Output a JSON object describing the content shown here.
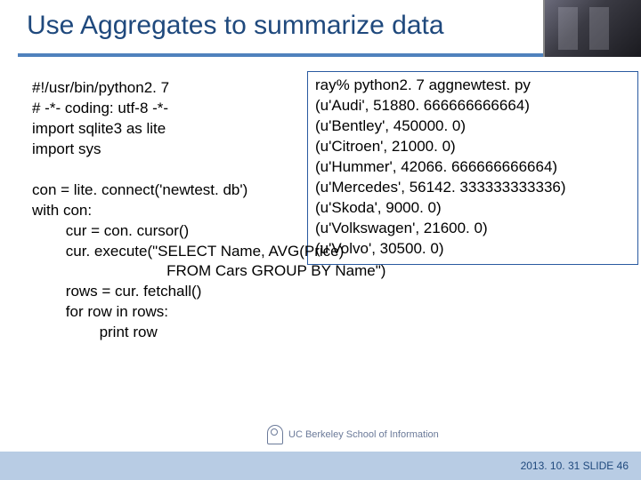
{
  "title": "Use Aggregates to summarize data",
  "code": "#!/usr/bin/python2. 7\n# -*- coding: utf-8 -*-\nimport sqlite3 as lite\nimport sys\n\ncon = lite. connect('newtest. db')\nwith con:\n        cur = con. cursor()\n        cur. execute(\"SELECT Name, AVG(Price)\n                                FROM Cars GROUP BY Name\")\n        rows = cur. fetchall()\n        for row in rows:\n                print row",
  "output": "ray% python2. 7 aggnewtest. py\n(u'Audi', 51880. 666666666664)\n(u'Bentley', 450000. 0)\n(u'Citroen', 21000. 0)\n(u'Hummer', 42066. 666666666664)\n(u'Mercedes', 56142. 333333333336)\n(u'Skoda', 9000. 0)\n(u'Volkswagen', 21600. 0)\n(u'Volvo', 30500. 0)",
  "logo_text": "UC Berkeley School of Information",
  "footer": "2013. 10. 31 SLIDE 46"
}
